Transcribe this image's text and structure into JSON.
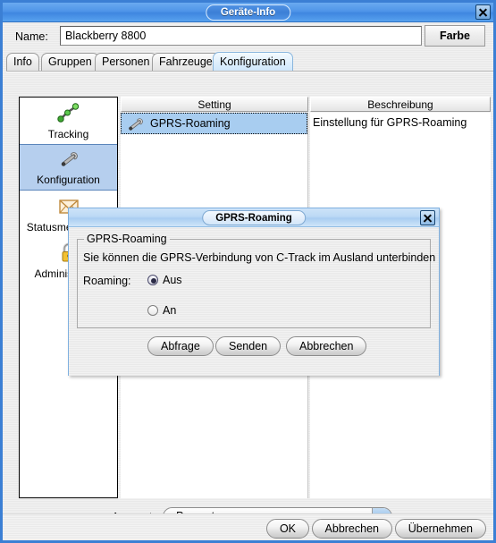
{
  "window": {
    "title": "Geräte-Info",
    "close_icon": "close-icon"
  },
  "name_row": {
    "label": "Name:",
    "value": "Blackberry 8800",
    "placeholder": "",
    "color_button": "Farbe"
  },
  "tabs": [
    {
      "label": "Info",
      "active": false
    },
    {
      "label": "Gruppen",
      "active": false
    },
    {
      "label": "Personen",
      "active": false
    },
    {
      "label": "Fahrzeuge",
      "active": false
    },
    {
      "label": "Konfiguration",
      "active": true
    }
  ],
  "sidebar": {
    "items": [
      {
        "label": "Tracking",
        "icon": "tracking-route-icon",
        "selected": false
      },
      {
        "label": "Konfiguration",
        "icon": "wrench-icon",
        "selected": true
      },
      {
        "label": "Statusmeldungen",
        "icon": "envelope-icon",
        "selected": false
      },
      {
        "label": "Administration",
        "icon": "padlock-icon",
        "selected": false
      }
    ]
  },
  "table": {
    "headers": [
      "Setting",
      "Beschreibung"
    ],
    "rows": [
      {
        "setting": "GPRS-Roaming",
        "icon": "wrench-icon",
        "beschreibung": "Einstellung für GPRS-Roaming",
        "selected": true
      }
    ]
  },
  "account": {
    "label": "Account:",
    "value": "Presentec",
    "options": [
      "Presentec"
    ],
    "caret_icon": "chevron-down-icon"
  },
  "footer": {
    "ok": "OK",
    "cancel": "Abbrechen",
    "apply": "Übernehmen"
  },
  "dialog": {
    "title": "GPRS-Roaming",
    "close_icon": "close-icon",
    "group_legend": "GPRS-Roaming",
    "description": "Sie können die GPRS-Verbindung von C-Track im Ausland unterbinden",
    "roaming_label": "Roaming:",
    "options": [
      {
        "label": "Aus",
        "checked": true
      },
      {
        "label": "An",
        "checked": false
      }
    ],
    "buttons": {
      "query": "Abfrage",
      "send": "Senden",
      "cancel": "Abbrechen"
    }
  },
  "colors": {
    "titlebar_blue": "#4f95e8",
    "window_border": "#3b7fd4",
    "selection_blue": "#a8cdf0",
    "sidebar_selection": "#b6cfee",
    "dialog_titlebar": "#bcd9f5",
    "panel_gray": "#eeeeee"
  }
}
